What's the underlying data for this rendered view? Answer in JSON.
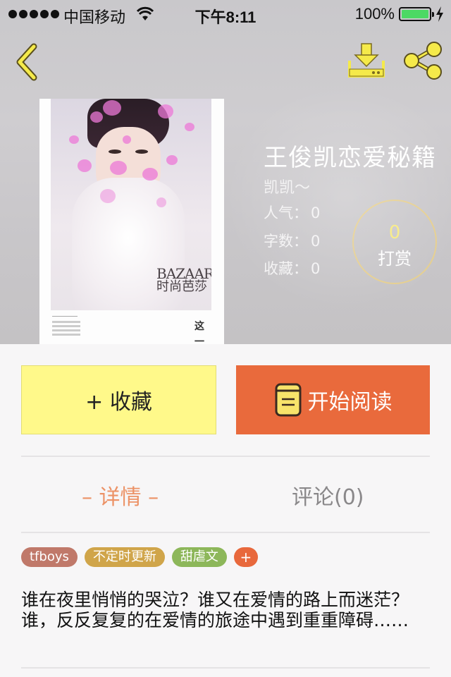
{
  "status_bar": {
    "carrier": "中国移动",
    "time": "下午8:11",
    "battery_percent": "100%"
  },
  "nav": {
    "back_icon": "chevron-left-icon",
    "download_icon": "download-icon",
    "share_icon": "share-icon",
    "icon_color": "#f5ea4a"
  },
  "book": {
    "title": "王俊凯恋爱秘籍",
    "author": "凯凯～",
    "stats": {
      "popularity_label": "人气：",
      "popularity_value": "0",
      "words_label": "字数：",
      "words_value": "0",
      "favorites_label": "收藏：",
      "favorites_value": "0"
    },
    "reward": {
      "count": "0",
      "label": "打赏"
    },
    "cover": {
      "magazine_en": "BAZAAR",
      "magazine_cn": "时尚芭莎",
      "side_text": "这一刻"
    }
  },
  "actions": {
    "collect_label": "+ 收藏",
    "read_label": "开始阅读",
    "collect_color": "#fff98a",
    "read_color": "#e96a3c"
  },
  "tabs": [
    {
      "label": "– 详情 –",
      "active": true
    },
    {
      "label": "评论(0)",
      "active": false
    }
  ],
  "tags": [
    {
      "label": "tfboys",
      "color": "#c0796a"
    },
    {
      "label": "不定时更新",
      "color": "#d0a54a"
    },
    {
      "label": "甜虐文",
      "color": "#8db75a"
    }
  ],
  "tag_add": {
    "label": "+",
    "color": "#e8683c"
  },
  "description": "谁在夜里悄悄的哭泣？谁又在爱情的路上而迷茫？谁，反反复复的在爱情的旅途中遇到重重障碍……"
}
